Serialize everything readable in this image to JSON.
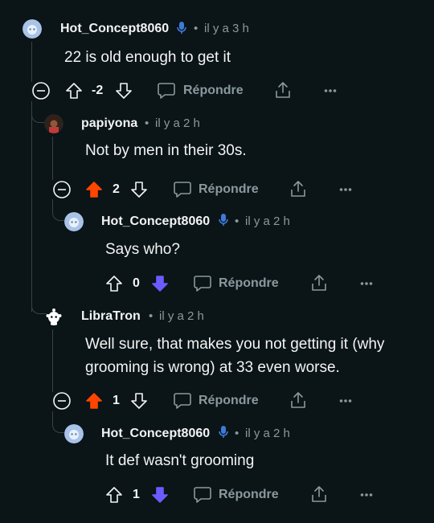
{
  "colors": {
    "background": "#0b1416",
    "text": "#f2f4f5",
    "muted": "#8a999f",
    "thread_line": "#3a4246",
    "upvote_active": "#ff4500",
    "downvote_active": "#6a5cff",
    "mod_mic": "#3d7bd9"
  },
  "comments": [
    {
      "username": "Hot_Concept8060",
      "has_mic_icon": true,
      "time": "il y a 3 h",
      "body": "22 is old enough to get it",
      "score": "-2",
      "vote_state": "none",
      "reply_label": "Répondre"
    },
    {
      "username": "papiyona",
      "has_mic_icon": false,
      "time": "il y a 2 h",
      "body": "Not by men in their 30s.",
      "score": "2",
      "vote_state": "upvoted",
      "reply_label": "Répondre"
    },
    {
      "username": "Hot_Concept8060",
      "has_mic_icon": true,
      "time": "il y a 2 h",
      "body": "Says who?",
      "score": "0",
      "vote_state": "downvoted",
      "reply_label": "Répondre"
    },
    {
      "username": "LibraTron",
      "has_mic_icon": false,
      "time": "il y a 2 h",
      "body_lines": [
        "Well sure, that makes you not getting it (why",
        "grooming is wrong) at 33 even worse."
      ],
      "score": "1",
      "vote_state": "upvoted",
      "reply_label": "Répondre"
    },
    {
      "username": "Hot_Concept8060",
      "has_mic_icon": true,
      "time": "il y a 2 h",
      "body": "It def wasn't grooming",
      "score": "1",
      "vote_state": "downvoted",
      "reply_label": "Répondre"
    }
  ]
}
